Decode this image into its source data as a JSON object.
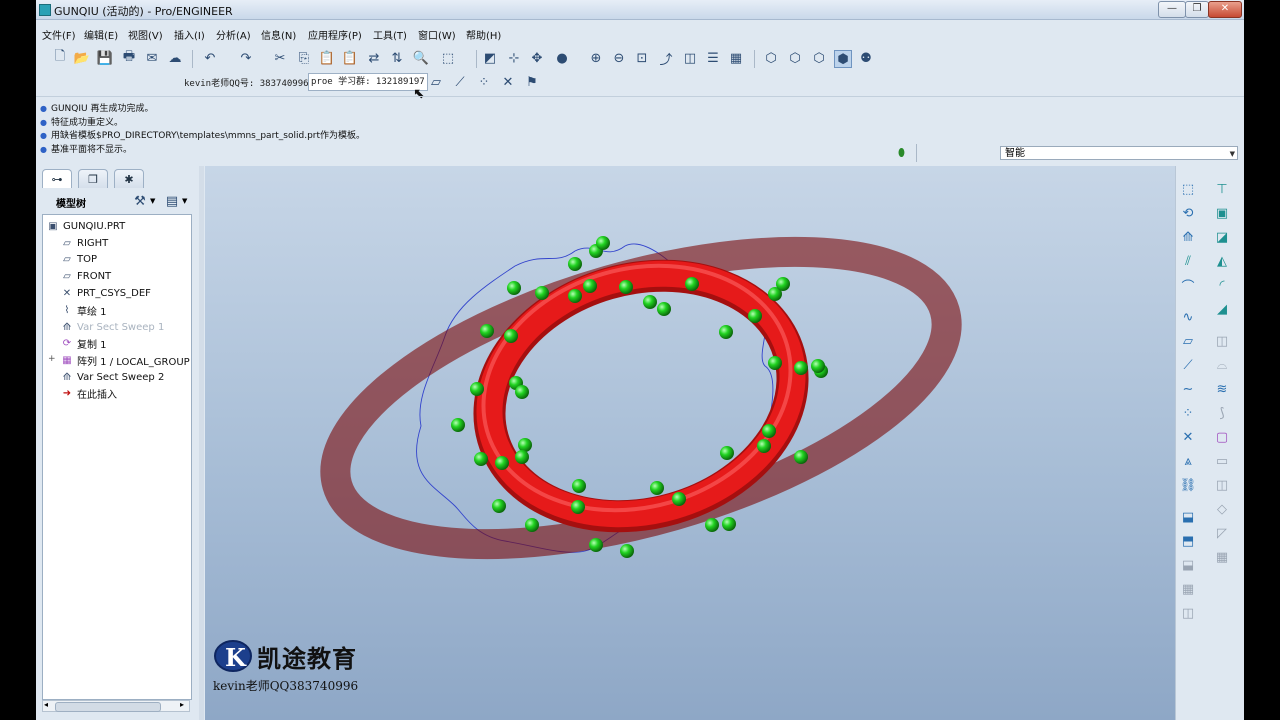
{
  "window": {
    "title": "GUNQIU (活动的) - Pro/ENGINEER",
    "controls": [
      "—",
      "❐",
      "✕"
    ]
  },
  "menubar": [
    "文件(F)",
    "编辑(E)",
    "视图(V)",
    "插入(I)",
    "分析(A)",
    "信息(N)",
    "应用程序(P)",
    "工具(T)",
    "窗口(W)",
    "帮助(H)"
  ],
  "toolbar2": {
    "text1": "kevin老师QQ号: 383740996",
    "text2": "proe 学习群: 132189197"
  },
  "messages": [
    "GUNQIU 再生成功完成。",
    "特征成功重定义。",
    "用缺省模板$PRO_DIRECTORY\\templates\\mmns_part_solid.prt作为模板。",
    "基准平面将不显示。"
  ],
  "filter": {
    "value": "智能"
  },
  "model_tree": {
    "label": "模型树",
    "items": [
      {
        "label": "GUNQIU.PRT",
        "icon": "part-icon"
      },
      {
        "label": "RIGHT",
        "icon": "datum-plane-icon"
      },
      {
        "label": "TOP",
        "icon": "datum-plane-icon"
      },
      {
        "label": "FRONT",
        "icon": "datum-plane-icon"
      },
      {
        "label": "PRT_CSYS_DEF",
        "icon": "csys-icon"
      },
      {
        "label": "草绘 1",
        "icon": "sketch-icon"
      },
      {
        "label": "Var Sect Sweep 1",
        "icon": "sweep-icon"
      },
      {
        "label": "复制 1",
        "icon": "copy-icon"
      },
      {
        "label": "阵列 1 / LOCAL_GROUP",
        "icon": "pattern-icon"
      },
      {
        "label": "Var Sect Sweep 2",
        "icon": "sweep-icon"
      },
      {
        "label": "在此插入",
        "icon": "insert-here-icon"
      }
    ]
  },
  "watermark": {
    "brand": "凯途教育",
    "contact": "kevin老师QQ383740996"
  },
  "colors": {
    "torus": "#e61a1a",
    "spheres": "#21d321",
    "curve": "#3344cc"
  }
}
